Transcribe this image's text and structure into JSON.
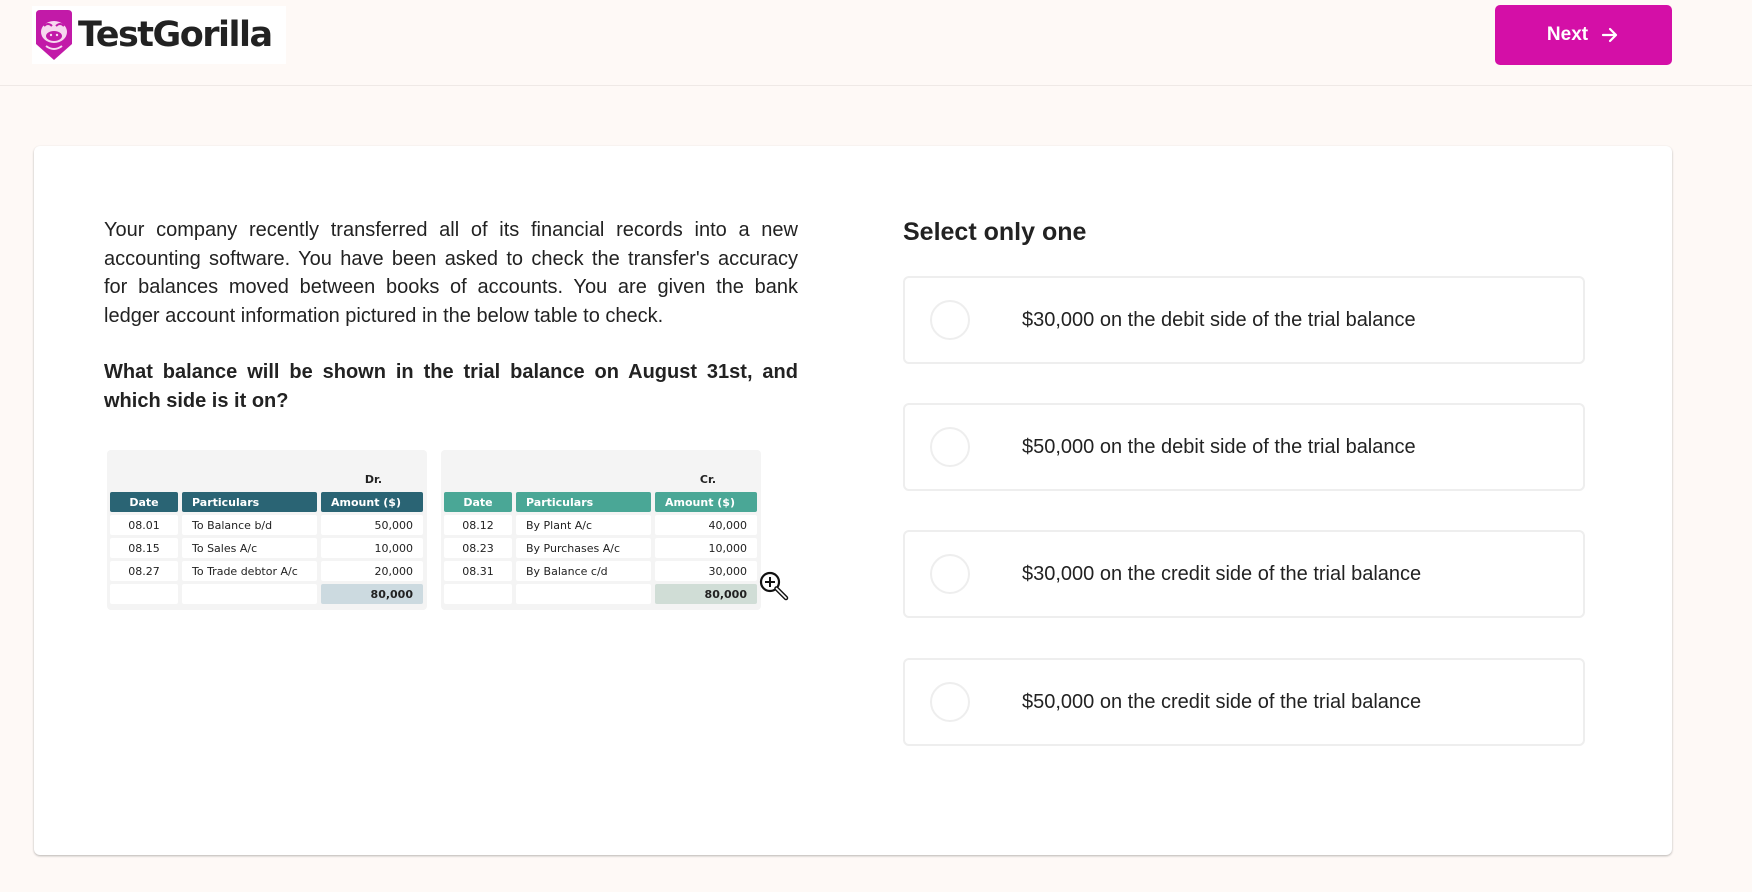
{
  "header": {
    "logo_text": "TestGorilla",
    "logo_icon": "gorilla-icon",
    "next_label": "Next",
    "next_icon": "arrow-right-icon"
  },
  "colors": {
    "brand": "#d40fa7",
    "page_bg": "#fef9f6",
    "debit_header": "#2a6474",
    "credit_header": "#4aa796",
    "debit_total": "#ccdae0",
    "credit_total": "#d0ddd6"
  },
  "question": {
    "intro": "Your company recently transferred all of its financial records into a new accounting software. You have been asked to check the transfer's accuracy for balances moved between books of accounts. You are given the bank ledger account information pictured in the below table to check.",
    "prompt": "What balance will be shown in the trial balance on August 31st, and which side is it on?"
  },
  "ledger": {
    "debit": {
      "label": "Dr.",
      "headers": [
        "Date",
        "Particulars",
        "Amount ($)"
      ],
      "rows": [
        [
          "08.01",
          "To Balance b/d",
          "50,000"
        ],
        [
          "08.15",
          "To Sales A/c",
          "10,000"
        ],
        [
          "08.27",
          "To Trade debtor A/c",
          "20,000"
        ]
      ],
      "total": "80,000"
    },
    "credit": {
      "label": "Cr.",
      "headers": [
        "Date",
        "Particulars",
        "Amount ($)"
      ],
      "rows": [
        [
          "08.12",
          "By Plant A/c",
          "40,000"
        ],
        [
          "08.23",
          "By Purchases A/c",
          "10,000"
        ],
        [
          "08.31",
          "By Balance c/d",
          "30,000"
        ]
      ],
      "total": "80,000"
    },
    "zoom_icon": "zoom-in-icon"
  },
  "answers": {
    "title": "Select only one",
    "options": [
      {
        "label": "$30,000 on the debit side of the trial balance",
        "selected": false
      },
      {
        "label": "$50,000 on the debit side of the trial balance",
        "selected": false
      },
      {
        "label": "$30,000 on the credit side of the trial balance",
        "selected": false
      },
      {
        "label": "$50,000 on the credit side of the trial balance",
        "selected": false
      }
    ]
  }
}
